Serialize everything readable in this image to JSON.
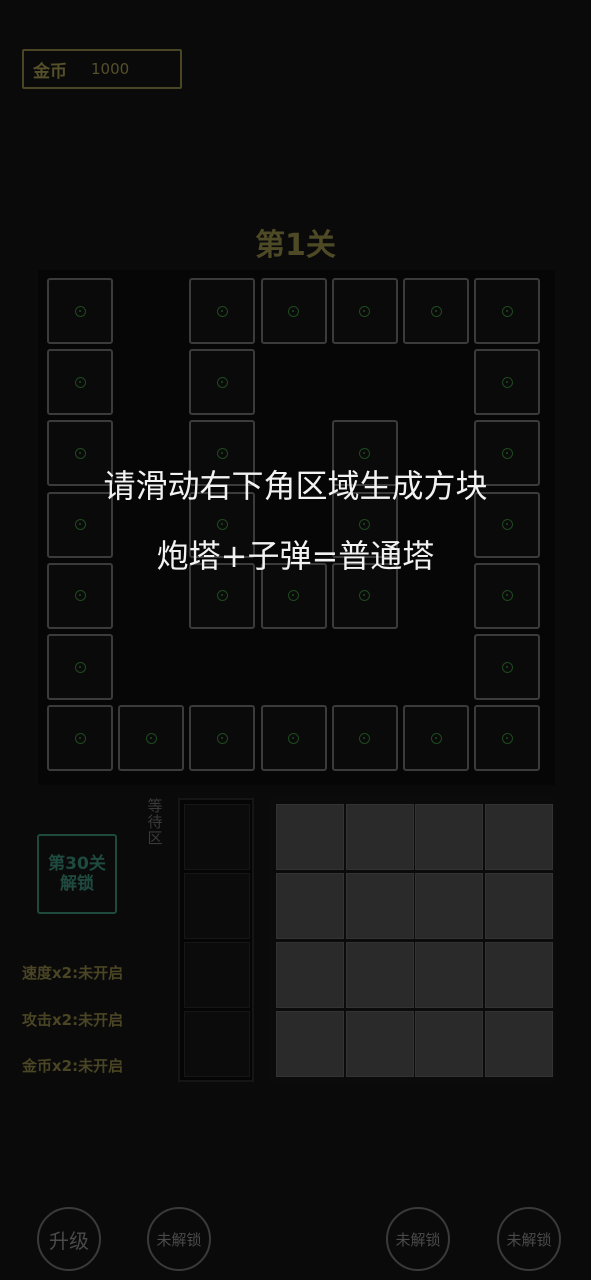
{
  "header": {
    "coin_label": "金币",
    "coin_value": "1000"
  },
  "level": {
    "title": "第1关"
  },
  "board": {
    "icon": "target-dot-icon",
    "cells": [
      [
        0,
        0
      ],
      [
        2,
        0
      ],
      [
        3,
        0
      ],
      [
        4,
        0
      ],
      [
        5,
        0
      ],
      [
        6,
        0
      ],
      [
        0,
        1
      ],
      [
        2,
        1
      ],
      [
        6,
        1
      ],
      [
        0,
        2
      ],
      [
        2,
        2
      ],
      [
        4,
        2
      ],
      [
        6,
        2
      ],
      [
        0,
        3
      ],
      [
        2,
        3
      ],
      [
        4,
        3
      ],
      [
        6,
        3
      ],
      [
        0,
        4
      ],
      [
        2,
        4
      ],
      [
        3,
        4
      ],
      [
        4,
        4
      ],
      [
        6,
        4
      ],
      [
        0,
        5
      ],
      [
        6,
        5
      ],
      [
        0,
        6
      ],
      [
        1,
        6
      ],
      [
        2,
        6
      ],
      [
        3,
        6
      ],
      [
        4,
        6
      ],
      [
        5,
        6
      ],
      [
        6,
        6
      ]
    ]
  },
  "overlay": {
    "line1": "请滑动右下角区域生成方块",
    "line2": "炮塔+子弹=普通塔"
  },
  "unlock": {
    "line1": "第30关",
    "line2": "解锁"
  },
  "wait_area": {
    "label": "等待区"
  },
  "stats": {
    "speed": "速度x2:未开启",
    "attack": "攻击x2:未开启",
    "coins": "金币x2:未开启"
  },
  "buttons": {
    "upgrade": "升级",
    "locked1": "未解锁",
    "locked2": "未解锁",
    "locked3": "未解锁"
  },
  "colors": {
    "background": "#0a0a0a",
    "accent": "#4a4524",
    "overlay_text": "#f2f2f2"
  }
}
